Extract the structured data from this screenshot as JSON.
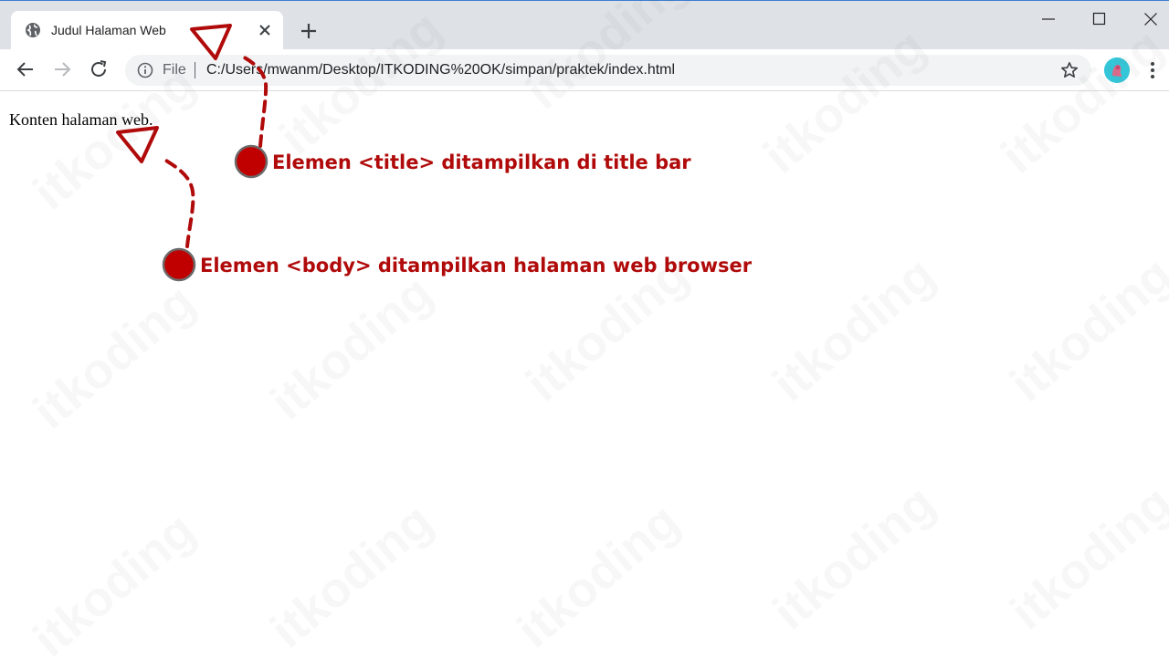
{
  "window": {
    "colors": {
      "accent": "#3c7fd1",
      "annotation": "#b00a0a",
      "annotation_dot": "#c00000"
    }
  },
  "tab": {
    "title": "Judul Halaman Web",
    "favicon": "globe-icon",
    "close_icon": "close-icon",
    "new_tab_icon": "plus-icon"
  },
  "window_controls": {
    "minimize_icon": "minimize-icon",
    "maximize_icon": "maximize-icon",
    "close_icon": "window-close-icon"
  },
  "toolbar": {
    "back_icon": "arrow-back-icon",
    "forward_icon": "arrow-forward-icon",
    "reload_icon": "reload-icon",
    "scheme": "File",
    "url": "C:/Users/mwanm/Desktop/ITKODING%20OK/simpan/praktek/index.html",
    "bookmark_icon": "star-icon",
    "menu_icon": "kebab-menu-icon"
  },
  "page": {
    "text": "Konten halaman web."
  },
  "annotations": {
    "title_label": "Elemen <title> ditampilkan di title bar",
    "body_label": "Elemen <body> ditampilkan halaman web browser"
  },
  "watermark": {
    "text": "itkoding"
  }
}
